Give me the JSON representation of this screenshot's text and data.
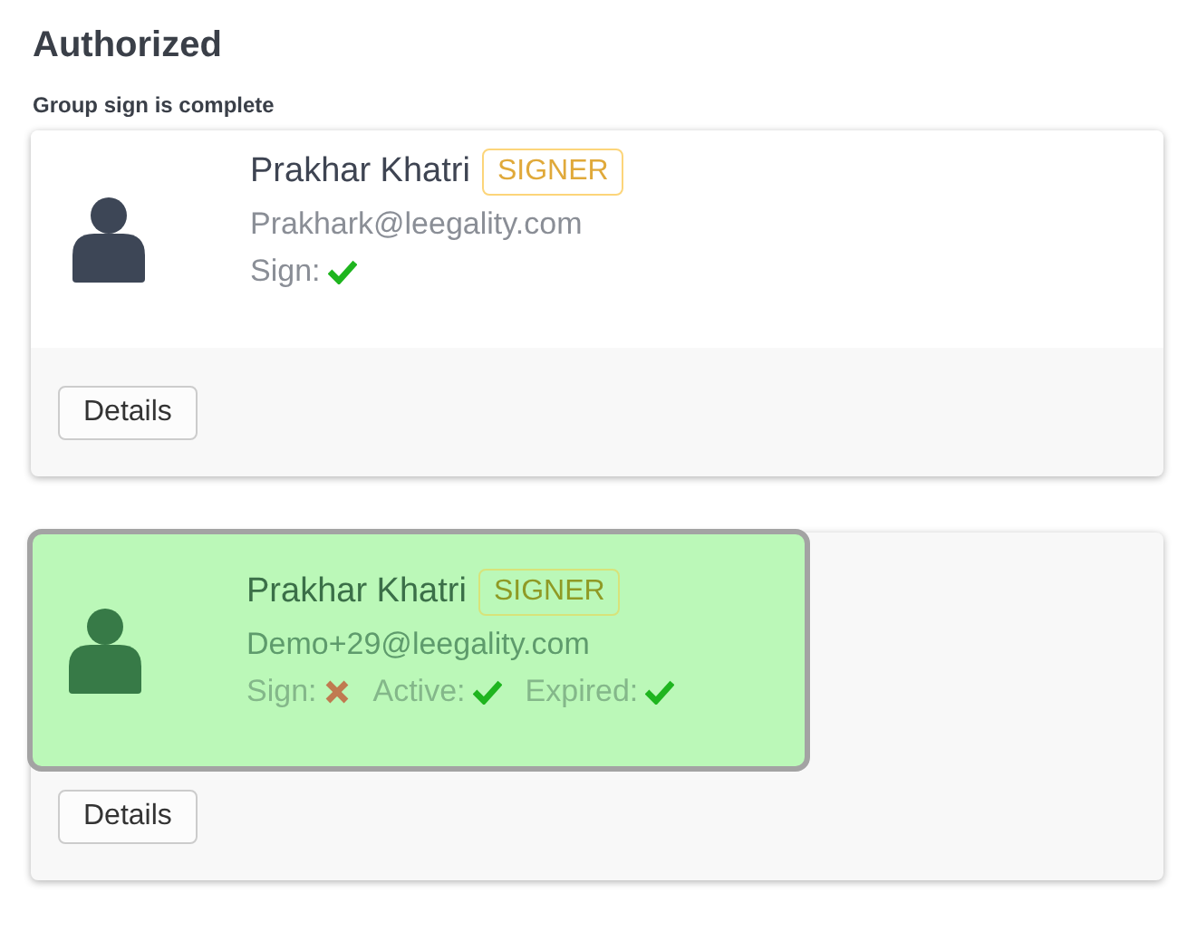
{
  "heading": "Authorized",
  "subheading": "Group sign is complete",
  "signers": [
    {
      "name": "Prakhar Khatri",
      "role": "SIGNER",
      "email": "Prakhark@leegality.com",
      "selected": false,
      "statuses": [
        {
          "label": "Sign:",
          "ok": true
        }
      ],
      "button": "Details"
    },
    {
      "name": "Prakhar Khatri",
      "role": "SIGNER",
      "email": "Demo+29@leegality.com",
      "selected": true,
      "statuses": [
        {
          "label": "Sign:",
          "ok": false
        },
        {
          "label": "Active:",
          "ok": true
        },
        {
          "label": "Expired:",
          "ok": true
        }
      ],
      "button": "Details"
    }
  ]
}
